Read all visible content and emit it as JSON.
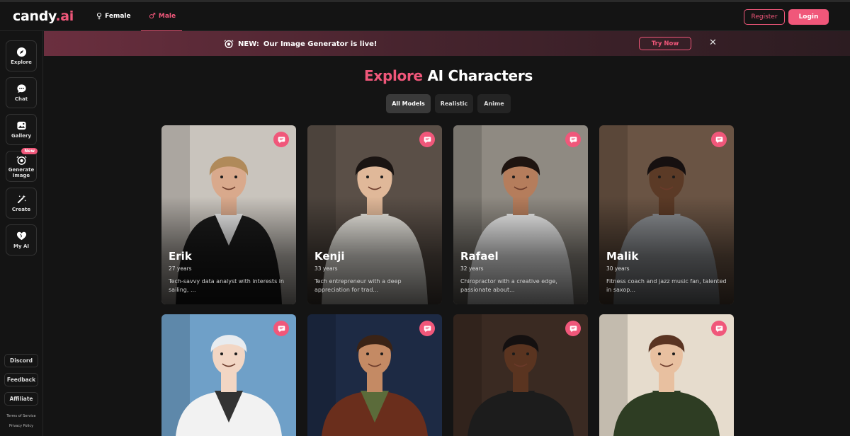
{
  "brand": {
    "name": "candy",
    "suffix": ".ai",
    "accent": "#f0577a"
  },
  "nav": {
    "tabs": [
      {
        "label": "Female",
        "icon": "female-icon"
      },
      {
        "label": "Male",
        "icon": "male-icon",
        "active": true
      }
    ]
  },
  "auth": {
    "register": "Register",
    "login": "Login"
  },
  "sidebar": {
    "items": [
      {
        "label": "Explore",
        "icon": "compass-icon"
      },
      {
        "label": "Chat",
        "icon": "chat-icon"
      },
      {
        "label": "Gallery",
        "icon": "gallery-icon"
      },
      {
        "label": "Generate Image",
        "icon": "generate-image-icon",
        "badge": "New"
      },
      {
        "label": "Create",
        "icon": "magic-wand-icon"
      },
      {
        "label": "My AI",
        "icon": "heart-icon"
      }
    ],
    "links": [
      "Discord",
      "Feedback",
      "Affiliate"
    ],
    "small_links": [
      "Terms of Service",
      "Privacy Policy"
    ]
  },
  "banner": {
    "prefix": "NEW:",
    "text": "Our Image Generator is live!",
    "cta": "Try Now",
    "close_icon": "close-icon"
  },
  "heading": {
    "accent": "Explore",
    "rest": "AI Characters"
  },
  "filters": [
    {
      "label": "All Models",
      "active": true
    },
    {
      "label": "Realistic"
    },
    {
      "label": "Anime"
    }
  ],
  "characters": [
    {
      "name": "Erik",
      "age": "27 years",
      "desc": "Tech-savvy data analyst with interests in sailing, ...",
      "style": "realistic",
      "shirt": "#1b1b1b",
      "inner": "#eeeeee",
      "skin": "#d9a98c",
      "hair": "#b08a5a",
      "bg": "#c9c4bd"
    },
    {
      "name": "Kenji",
      "age": "33 years",
      "desc": "Tech entrepreneur with a deep appreciation for trad...",
      "style": "realistic",
      "shirt": "#efece5",
      "inner": "#efece5",
      "skin": "#e0b899",
      "hair": "#1a1412",
      "bg": "#5a4f47"
    },
    {
      "name": "Rafael",
      "age": "32 years",
      "desc": "Chiropractor with a creative edge, passionate about...",
      "style": "realistic",
      "shirt": "#f1f1f1",
      "inner": "#f1f1f1",
      "skin": "#b57d5c",
      "hair": "#1e1410",
      "bg": "#8f8a82"
    },
    {
      "name": "Malik",
      "age": "30 years",
      "desc": "Fitness coach and jazz music fan, talented in saxop...",
      "style": "realistic",
      "shirt": "#8c8f93",
      "inner": "#8c8f93",
      "skin": "#5b3a26",
      "hair": "#161010",
      "bg": "#6a5444"
    },
    {
      "name": "",
      "age": "",
      "desc": "",
      "style": "anime",
      "shirt": "#f2f2f2",
      "inner": "#333",
      "skin": "#f2d6c4",
      "hair": "#e8ecf0",
      "bg": "#6fa0c8"
    },
    {
      "name": "",
      "age": "",
      "desc": "",
      "style": "anime",
      "shirt": "#6a2e1c",
      "inner": "#5b6b3a",
      "skin": "#c48a64",
      "hair": "#3a2316",
      "bg": "#1d2a44"
    },
    {
      "name": "",
      "age": "",
      "desc": "",
      "style": "anime",
      "shirt": "#1c1c1c",
      "inner": "#1c1c1c",
      "skin": "#5a3420",
      "hair": "#141010",
      "bg": "#3a2a22"
    },
    {
      "name": "",
      "age": "",
      "desc": "",
      "style": "anime",
      "shirt": "#2e3d23",
      "inner": "#2e3d23",
      "skin": "#e8c0a0",
      "hair": "#5a3422",
      "bg": "#e6dccd"
    }
  ]
}
